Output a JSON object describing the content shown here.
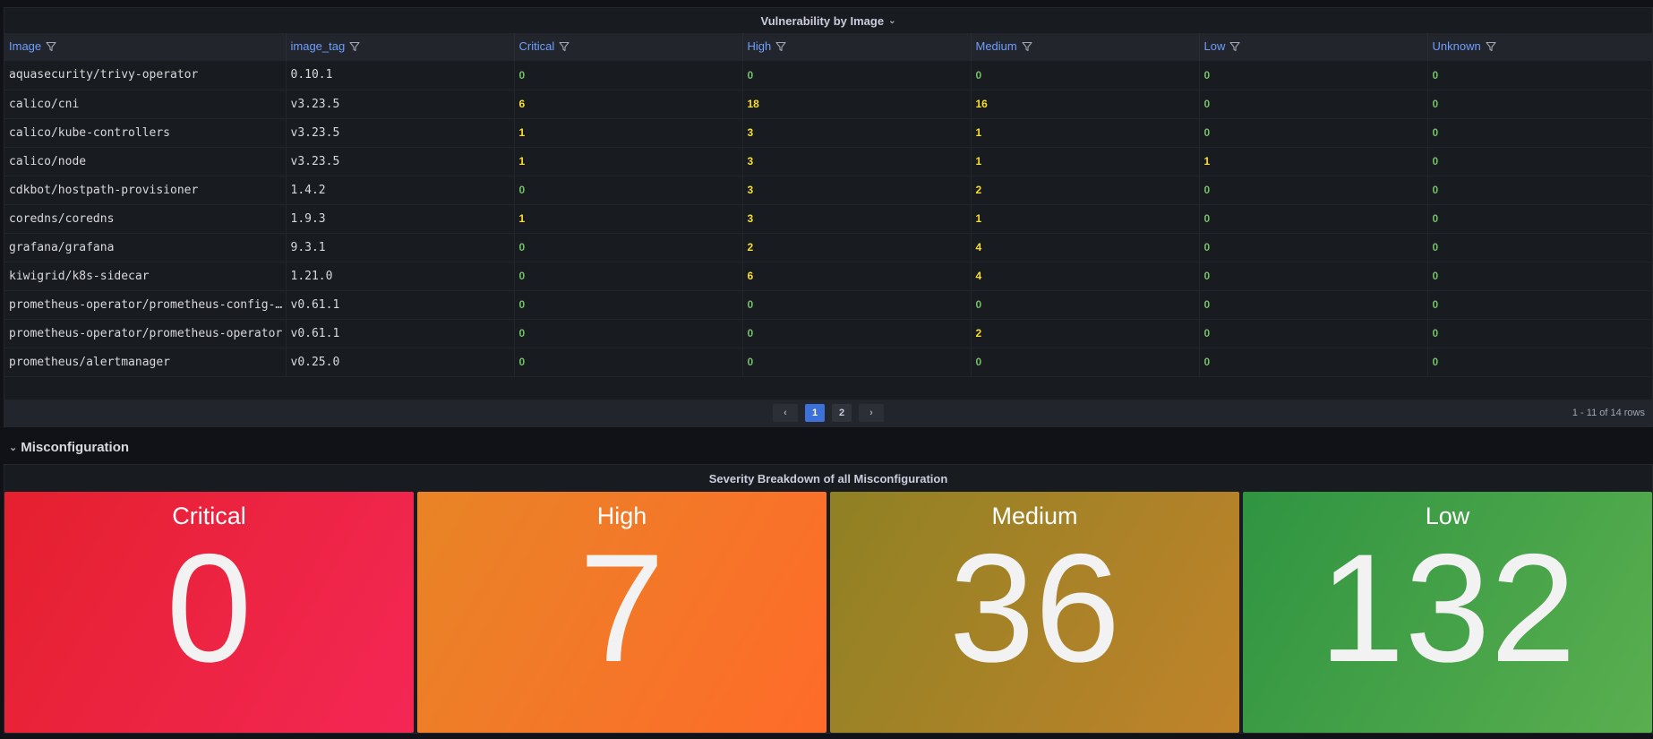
{
  "vuln_panel": {
    "title": "Vulnerability by Image",
    "columns": [
      "Image",
      "image_tag",
      "Critical",
      "High",
      "Medium",
      "Low",
      "Unknown"
    ],
    "rows": [
      {
        "image": "aquasecurity/trivy-operator",
        "tag": "0.10.1",
        "critical": "0",
        "high": "0",
        "medium": "0",
        "low": "0",
        "unknown": "0"
      },
      {
        "image": "calico/cni",
        "tag": "v3.23.5",
        "critical": "6",
        "high": "18",
        "medium": "16",
        "low": "0",
        "unknown": "0"
      },
      {
        "image": "calico/kube-controllers",
        "tag": "v3.23.5",
        "critical": "1",
        "high": "3",
        "medium": "1",
        "low": "0",
        "unknown": "0"
      },
      {
        "image": "calico/node",
        "tag": "v3.23.5",
        "critical": "1",
        "high": "3",
        "medium": "1",
        "low": "1",
        "unknown": "0"
      },
      {
        "image": "cdkbot/hostpath-provisioner",
        "tag": "1.4.2",
        "critical": "0",
        "high": "3",
        "medium": "2",
        "low": "0",
        "unknown": "0"
      },
      {
        "image": "coredns/coredns",
        "tag": "1.9.3",
        "critical": "1",
        "high": "3",
        "medium": "1",
        "low": "0",
        "unknown": "0"
      },
      {
        "image": "grafana/grafana",
        "tag": "9.3.1",
        "critical": "0",
        "high": "2",
        "medium": "4",
        "low": "0",
        "unknown": "0"
      },
      {
        "image": "kiwigrid/k8s-sidecar",
        "tag": "1.21.0",
        "critical": "0",
        "high": "6",
        "medium": "4",
        "low": "0",
        "unknown": "0"
      },
      {
        "image": "prometheus-operator/prometheus-config-…",
        "tag": "v0.61.1",
        "critical": "0",
        "high": "0",
        "medium": "0",
        "low": "0",
        "unknown": "0"
      },
      {
        "image": "prometheus-operator/prometheus-operator",
        "tag": "v0.61.1",
        "critical": "0",
        "high": "0",
        "medium": "2",
        "low": "0",
        "unknown": "0"
      },
      {
        "image": "prometheus/alertmanager",
        "tag": "v0.25.0",
        "critical": "0",
        "high": "0",
        "medium": "0",
        "low": "0",
        "unknown": "0"
      }
    ],
    "pagination": {
      "prev": "‹",
      "pages": [
        "1",
        "2"
      ],
      "next": "›",
      "active": "1"
    },
    "row_count": "1 - 11 of 14 rows",
    "colors": {
      "zero": "#73bf69",
      "nonzero": "#fade2a"
    }
  },
  "section": {
    "title": "Misconfiguration"
  },
  "misc_panel": {
    "title": "Severity Breakdown of all Misconfiguration",
    "tiles": [
      {
        "label": "Critical",
        "value": "0",
        "color": "#e5202e"
      },
      {
        "label": "High",
        "value": "7",
        "color": "#ff7a2a"
      },
      {
        "label": "Medium",
        "value": "36",
        "color": "#a8822a"
      },
      {
        "label": "Low",
        "value": "132",
        "color": "#3f9c46"
      }
    ]
  }
}
